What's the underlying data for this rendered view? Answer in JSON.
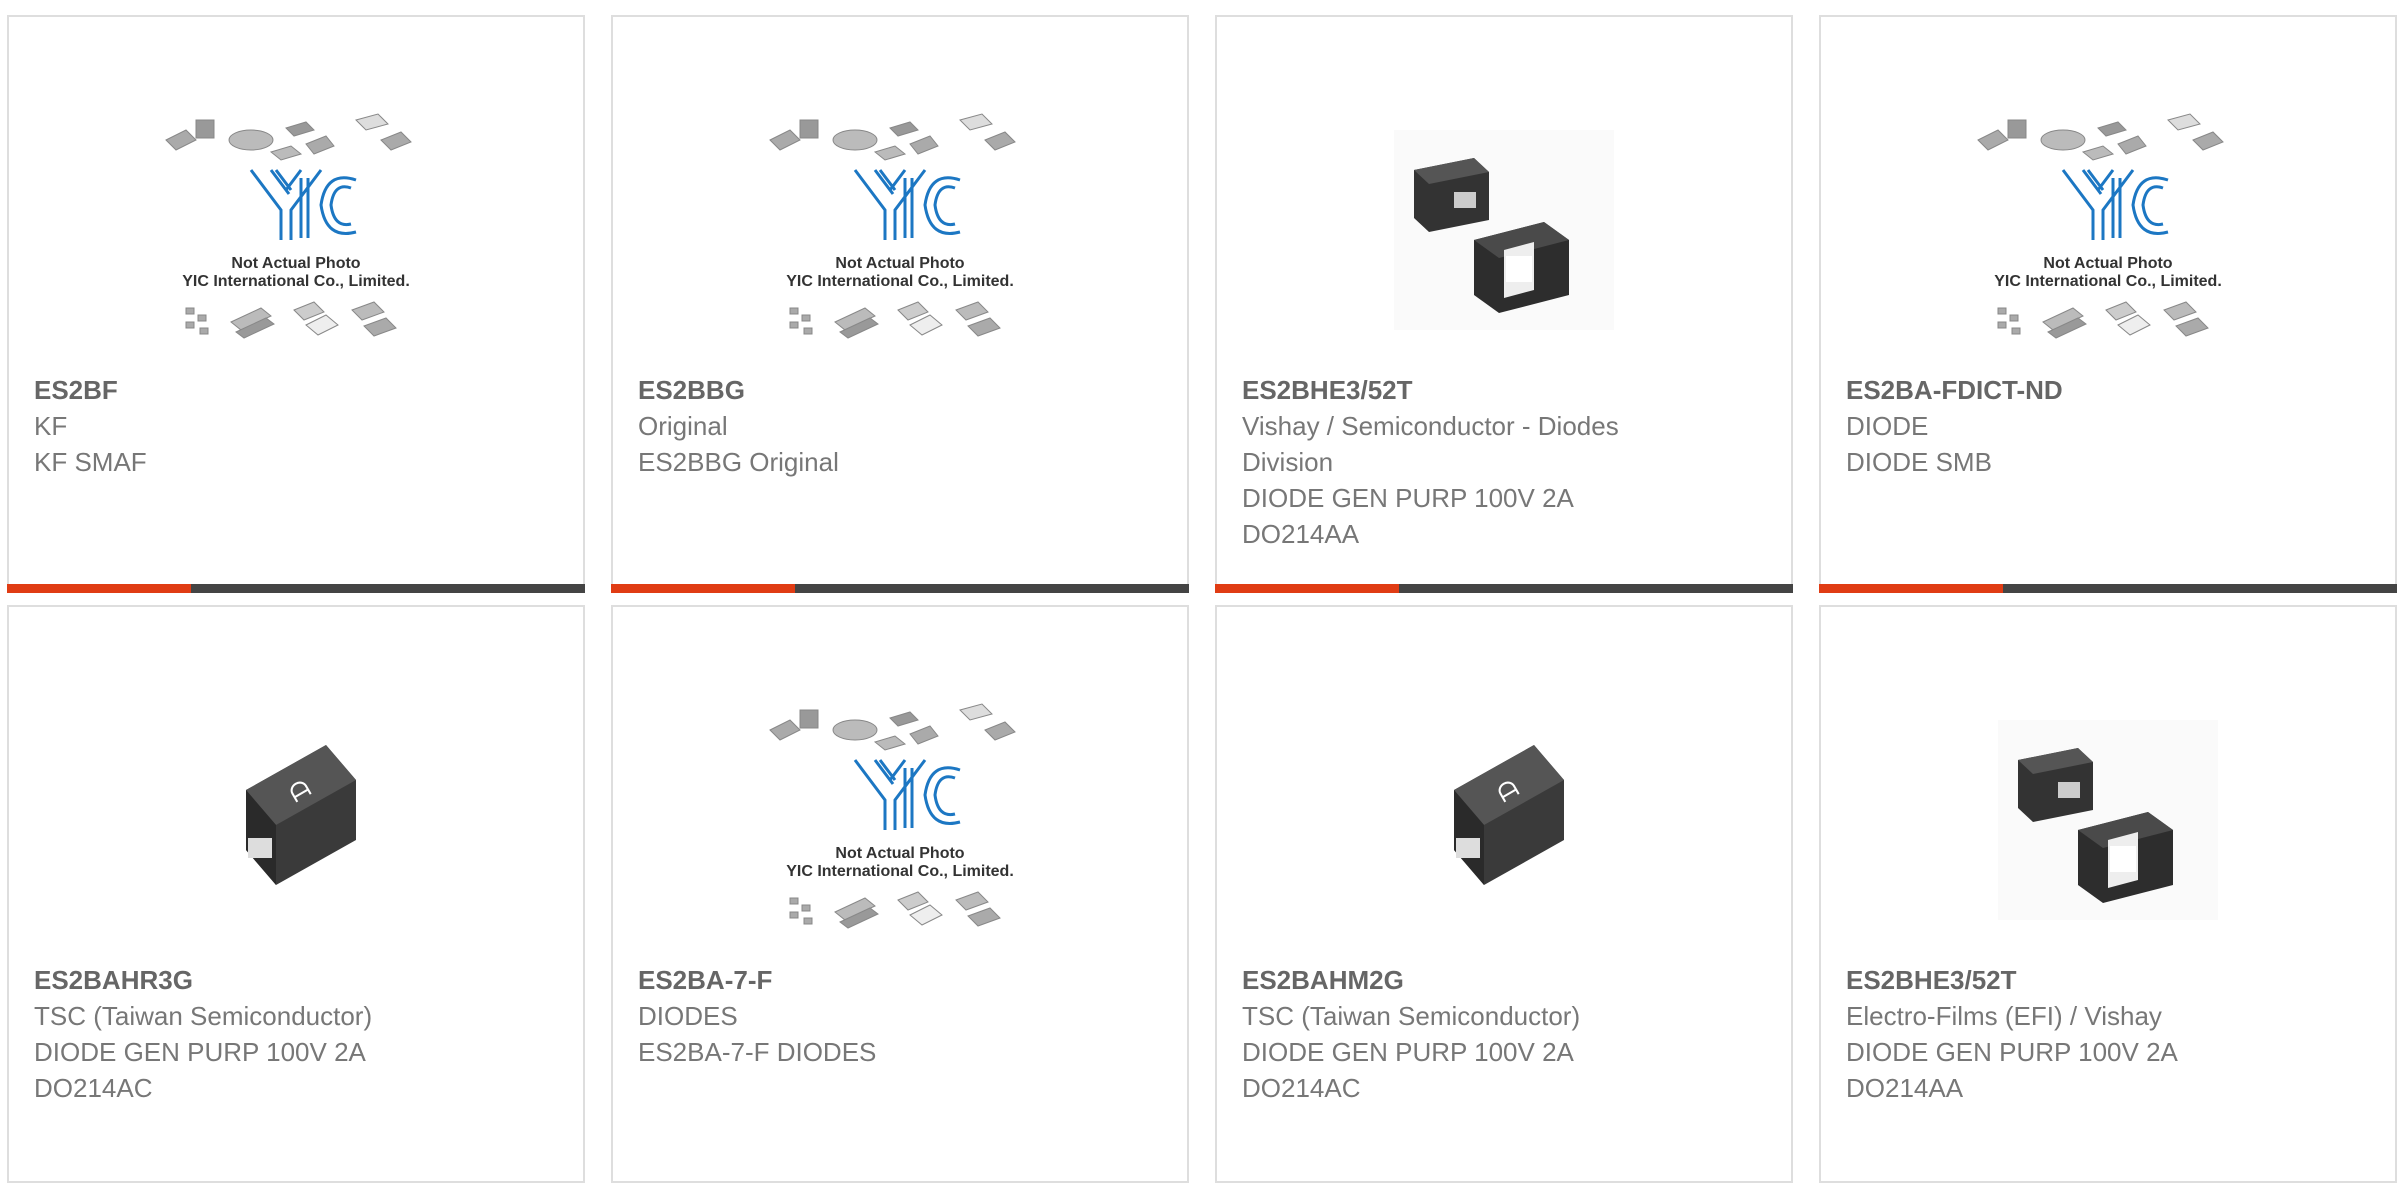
{
  "products": [
    {
      "part": "ES2BF",
      "line1": "KF",
      "line2": "KF SMAF",
      "line3": "",
      "image": "yic-placeholder"
    },
    {
      "part": "ES2BBG",
      "line1": "Original",
      "line2": "ES2BBG Original",
      "line3": "",
      "image": "yic-placeholder"
    },
    {
      "part": "ES2BHE3/52T",
      "line1": "Vishay / Semiconductor - Diodes",
      "line2": "Division",
      "line3": "DIODE GEN PURP 100V 2A",
      "line4": "DO214AA",
      "image": "smb-pair"
    },
    {
      "part": "ES2BA-FDICT-ND",
      "line1": "DIODE",
      "line2": "DIODE SMB",
      "line3": "",
      "image": "yic-placeholder"
    },
    {
      "part": "ES2BAHR3G",
      "line1": "TSC (Taiwan Semiconductor)",
      "line2": "DIODE GEN PURP 100V 2A",
      "line3": "DO214AC",
      "image": "tsc-diode"
    },
    {
      "part": "ES2BA-7-F",
      "line1": "DIODES",
      "line2": "ES2BA-7-F DIODES",
      "line3": "",
      "image": "yic-placeholder"
    },
    {
      "part": "ES2BAHM2G",
      "line1": "TSC (Taiwan Semiconductor)",
      "line2": "DIODE GEN PURP 100V 2A",
      "line3": "DO214AC",
      "image": "tsc-diode"
    },
    {
      "part": "ES2BHE3/52T",
      "line1": "Electro-Films (EFI) / Vishay",
      "line2": "DIODE GEN PURP 100V 2A",
      "line3": "DO214AA",
      "image": "smb-pair"
    }
  ],
  "placeholder": {
    "line1": "Not Actual Photo",
    "line2": "YIC International Co., Limited."
  },
  "colors": {
    "accent": "#e03c14",
    "bar": "#444444",
    "border": "#dedede",
    "logo_blue": "#1c77c3"
  }
}
